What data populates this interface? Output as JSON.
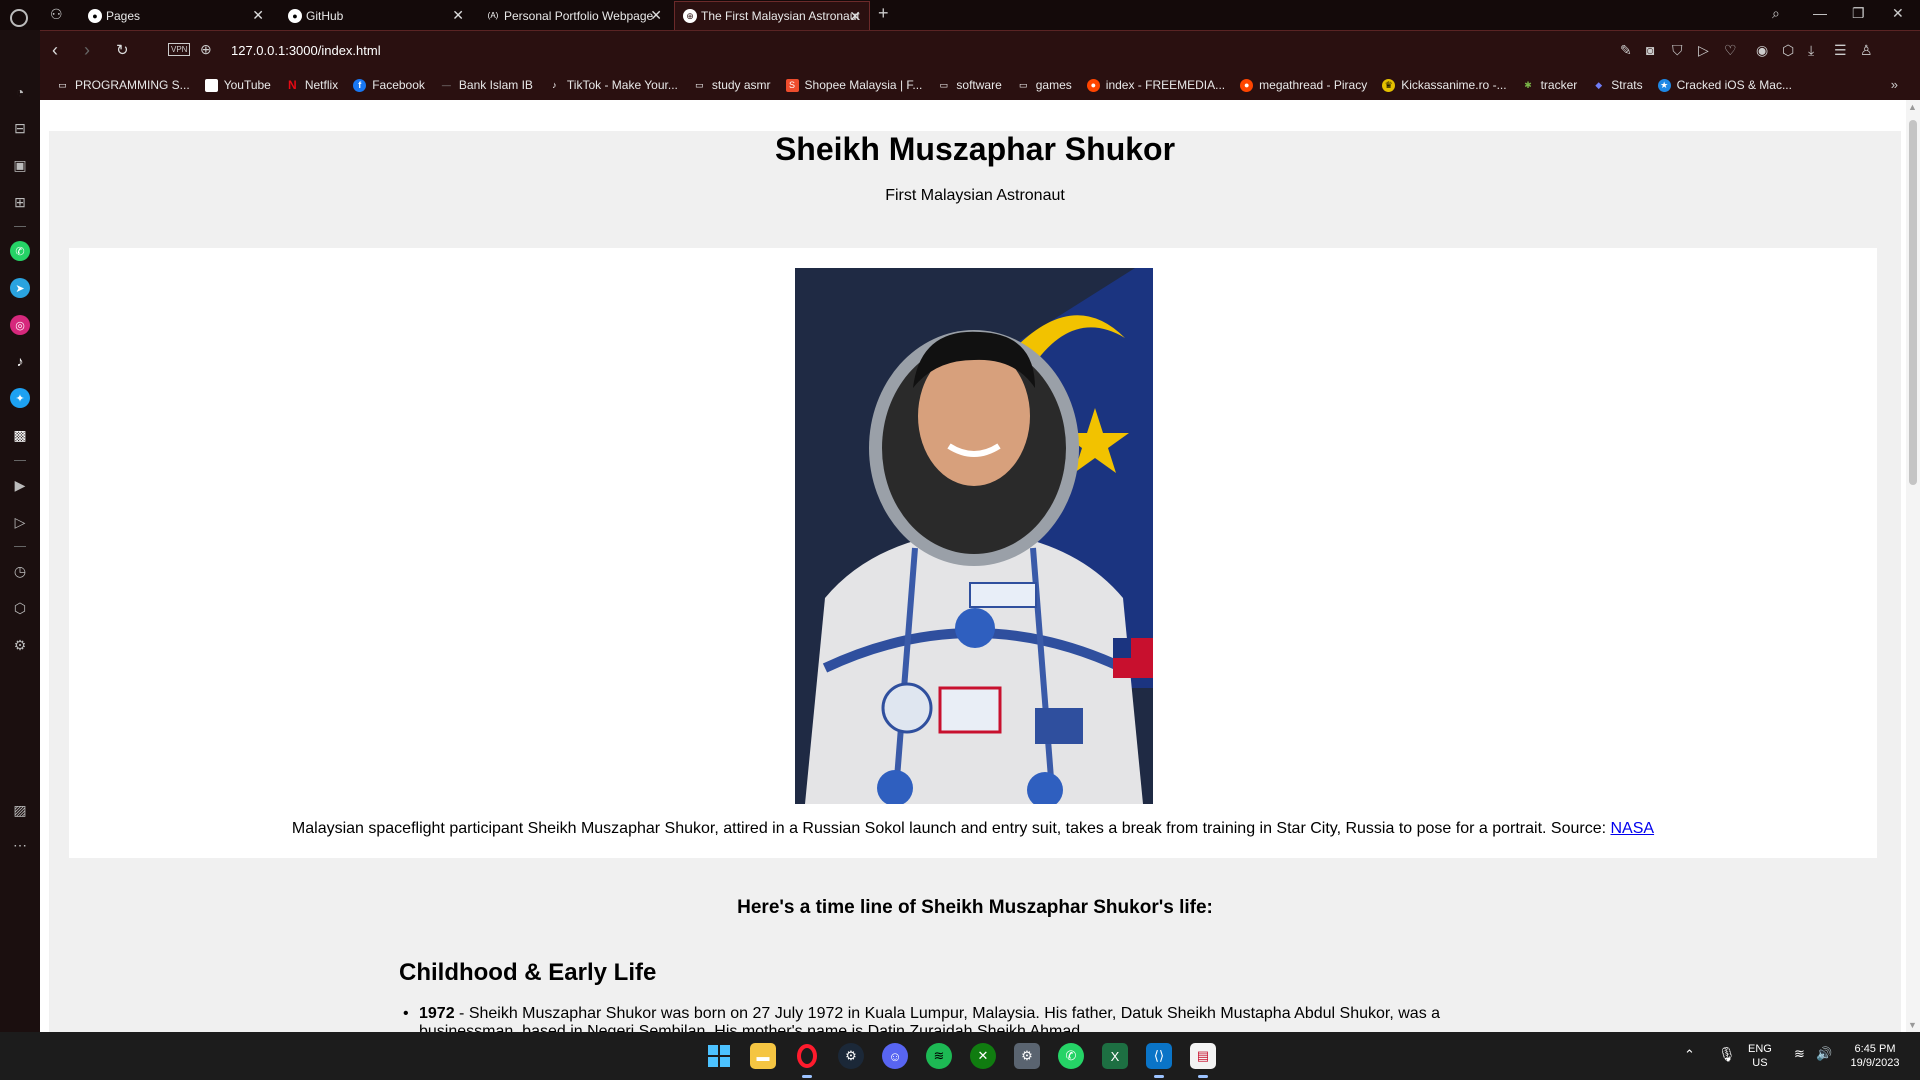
{
  "tabs": [
    {
      "title": "Pages",
      "icon": "github-icon",
      "active": false
    },
    {
      "title": "GitHub",
      "icon": "github-icon",
      "active": false
    },
    {
      "title": "Personal Portfolio Webpage",
      "icon": "freecodecamp-icon",
      "active": false
    },
    {
      "title": "The First Malaysian Astronaut",
      "icon": "globe-icon",
      "active": true
    }
  ],
  "address_bar": {
    "vpn_label": "VPN",
    "url": "127.0.0.1:3000/index.html"
  },
  "bookmarks": [
    {
      "label": "PROGRAMMING S...",
      "icon": "folder-icon",
      "color": "#cccccc"
    },
    {
      "label": "YouTube",
      "icon": "page-icon",
      "color": "#ffffff"
    },
    {
      "label": "Netflix",
      "icon": "netflix-icon",
      "color": "#e50914"
    },
    {
      "label": "Facebook",
      "icon": "facebook-icon",
      "color": "#1877f2"
    },
    {
      "label": "Bank Islam IB",
      "icon": "bank-icon",
      "color": "#888888"
    },
    {
      "label": "TikTok - Make Your...",
      "icon": "tiktok-icon",
      "color": "#222222"
    },
    {
      "label": "study asmr",
      "icon": "folder-icon",
      "color": "#cccccc"
    },
    {
      "label": "Shopee Malaysia | F...",
      "icon": "shopee-icon",
      "color": "#ee4d2d"
    },
    {
      "label": "software",
      "icon": "folder-icon",
      "color": "#cccccc"
    },
    {
      "label": "games",
      "icon": "folder-icon",
      "color": "#cccccc"
    },
    {
      "label": "index - FREEMEDIA...",
      "icon": "reddit-icon",
      "color": "#ff4500"
    },
    {
      "label": "megathread - Piracy",
      "icon": "reddit-icon",
      "color": "#ff4500"
    },
    {
      "label": "Kickassanime.ro -...",
      "icon": "crown-icon",
      "color": "#e5c100"
    },
    {
      "label": "tracker",
      "icon": "tracker-icon",
      "color": "#7ab648"
    },
    {
      "label": "Strats",
      "icon": "diamond-icon",
      "color": "#6f7cf5"
    },
    {
      "label": "Cracked iOS & Mac...",
      "icon": "star-icon",
      "color": "#1e88e5"
    }
  ],
  "page": {
    "title": "Sheikh Muszaphar Shukor",
    "subtitle": "First Malaysian Astronaut",
    "caption": "Malaysian spaceflight participant Sheikh Muszaphar Shukor, attired in a Russian Sokol launch and entry suit, takes a break from training in Star City, Russia to pose for a portrait. Source: ",
    "caption_link": "NASA",
    "timeline_intro": "Here's a time line of Sheikh Muszaphar Shukor's life:",
    "section_heading": "Childhood & Early Life",
    "timeline": [
      {
        "year": "1972",
        "text": " - Sheikh Muszaphar Shukor was born on 27 July 1972 in Kuala Lumpur, Malaysia. His father, Datuk Sheikh Mustapha Abdul Shukor, was a businessman, based in Negeri Sembilan. His mother's name is Datin Zuraidah Sheikh Ahmad."
      }
    ]
  },
  "taskbar": {
    "apps": [
      "windows-start-icon",
      "file-explorer-icon",
      "opera-icon",
      "steam-icon",
      "discord-icon",
      "spotify-icon",
      "xbox-icon",
      "settings-icon",
      "whatsapp-icon",
      "excel-icon",
      "vscode-icon",
      "app-icon"
    ],
    "language": "ENG",
    "region": "US",
    "time": "6:45 PM",
    "date": "19/9/2023"
  }
}
